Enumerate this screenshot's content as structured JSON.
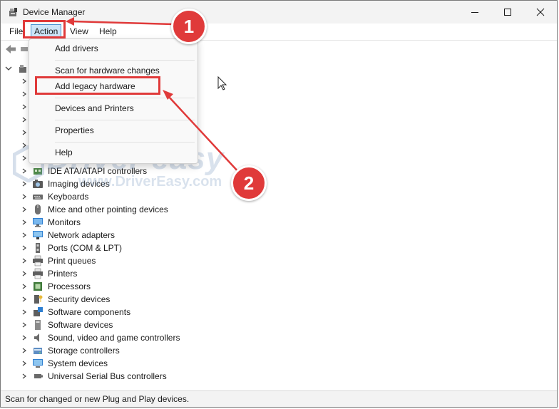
{
  "window": {
    "title": "Device Manager",
    "controls": [
      "minimize-icon",
      "maximize-icon",
      "close-icon"
    ]
  },
  "menu": {
    "items": [
      {
        "label": "File"
      },
      {
        "label": "Action"
      },
      {
        "label": "View"
      },
      {
        "label": "Help"
      }
    ]
  },
  "action_menu": {
    "items": [
      {
        "label": "Add drivers"
      },
      {
        "label": "Scan for hardware changes"
      },
      {
        "label": "Add legacy hardware"
      },
      {
        "label": "Devices and Printers"
      },
      {
        "label": "Properties"
      },
      {
        "label": "Help"
      }
    ]
  },
  "tree": {
    "items": [
      {
        "label": "IDE ATA/ATAPI controllers",
        "icon": "ide-controller-icon"
      },
      {
        "label": "Imaging devices",
        "icon": "camera-icon"
      },
      {
        "label": "Keyboards",
        "icon": "keyboard-icon"
      },
      {
        "label": "Mice and other pointing devices",
        "icon": "mouse-icon"
      },
      {
        "label": "Monitors",
        "icon": "monitor-icon"
      },
      {
        "label": "Network adapters",
        "icon": "network-adapter-icon"
      },
      {
        "label": "Ports (COM & LPT)",
        "icon": "port-icon"
      },
      {
        "label": "Print queues",
        "icon": "printer-icon"
      },
      {
        "label": "Printers",
        "icon": "printer-icon"
      },
      {
        "label": "Processors",
        "icon": "processor-icon"
      },
      {
        "label": "Security devices",
        "icon": "security-device-icon"
      },
      {
        "label": "Software components",
        "icon": "software-component-icon"
      },
      {
        "label": "Software devices",
        "icon": "software-device-icon"
      },
      {
        "label": "Sound, video and game controllers",
        "icon": "speaker-icon"
      },
      {
        "label": "Storage controllers",
        "icon": "storage-controller-icon"
      },
      {
        "label": "System devices",
        "icon": "system-device-icon"
      },
      {
        "label": "Universal Serial Bus controllers",
        "icon": "usb-icon"
      }
    ]
  },
  "status": {
    "text": "Scan for changed or new Plug and Play devices."
  },
  "callouts": {
    "one": "1",
    "two": "2"
  },
  "watermark": {
    "title": "Driver easy",
    "url": "www.DriverEasy.com"
  },
  "colors": {
    "highlight": "#e03a3a",
    "menu_active": "#cce4f7",
    "titlebar": "#f3f3f3"
  }
}
